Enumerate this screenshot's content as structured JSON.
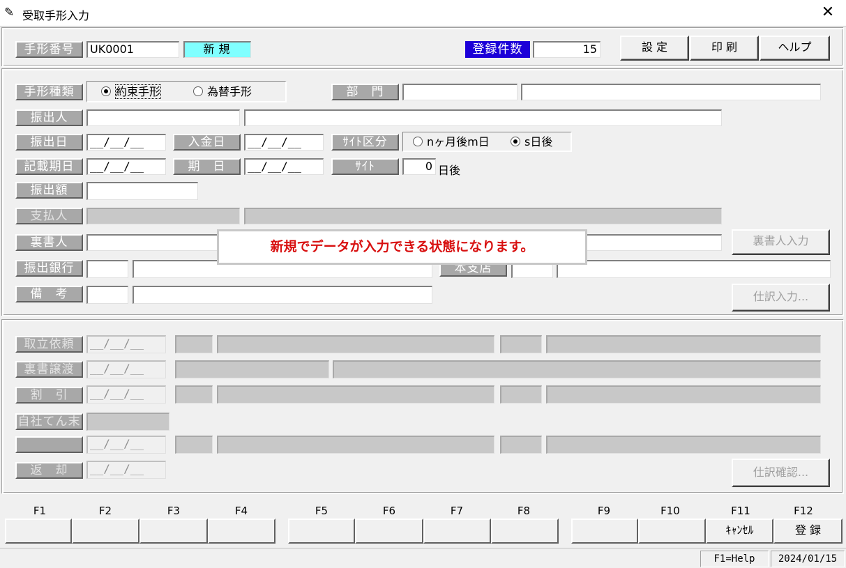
{
  "window": {
    "title": "受取手形入力",
    "close_icon": "close-icon"
  },
  "header": {
    "note_no_label": "手形番号",
    "note_no_value": "UK0001",
    "mode_value": "新規",
    "count_label": "登録件数",
    "count_value": "15",
    "btn_settings": "設 定",
    "btn_print": "印 刷",
    "btn_help": "ヘルプ"
  },
  "main": {
    "note_type_label": "手形種類",
    "note_type_options": [
      "約束手形",
      "為替手形"
    ],
    "note_type_selected": "約束手形",
    "dept_label": "部　門",
    "drawer_label": "振出人",
    "issue_date_label": "振出日",
    "deposit_date_label": "入金日",
    "site_kubun_label": "ｻｲﾄ区分",
    "site_kubun_options": [
      "nヶ月後m日",
      "s日後"
    ],
    "site_kubun_selected": "s日後",
    "record_date_label": "記載期日",
    "due_date_label": "期　日",
    "site_label": "ｻｲﾄ",
    "site_value": "0",
    "site_unit": "日後",
    "amount_label": "振出額",
    "payer_label": "支払人",
    "endorser_label": "裏書人",
    "endorser_btn": "裏書人入力",
    "bank_label": "振出銀行",
    "branch_label": "本支店",
    "remarks_label": "備　考",
    "journal_btn": "仕訳入力...",
    "date_placeholder": "__/__/__",
    "notice": "新規でデータが入力できる状態になります。"
  },
  "lower": {
    "collection_label": "取立依頼",
    "endorse_transfer_label": "裏書譲渡",
    "discount_label": "割　引",
    "self_settle_label": "自社てん末",
    "return_label": "返　却",
    "journal_confirm_btn": "仕訳確認..."
  },
  "fkeys": {
    "labels": [
      "F1",
      "F2",
      "F3",
      "F4",
      "F5",
      "F6",
      "F7",
      "F8",
      "F9",
      "F10",
      "F11",
      "F12"
    ],
    "buttons": [
      "",
      "",
      "",
      "",
      "",
      "",
      "",
      "",
      "",
      "",
      "ｷｬﾝｾﾙ",
      "登 録"
    ]
  },
  "status": {
    "help": "F1=Help",
    "date": "2024/01/15"
  },
  "colors": {
    "label_bg": "#a8a8a8",
    "count_label_bg": "#1c00d8",
    "mode_bg": "#80ffff",
    "notice_text": "#d81010"
  }
}
